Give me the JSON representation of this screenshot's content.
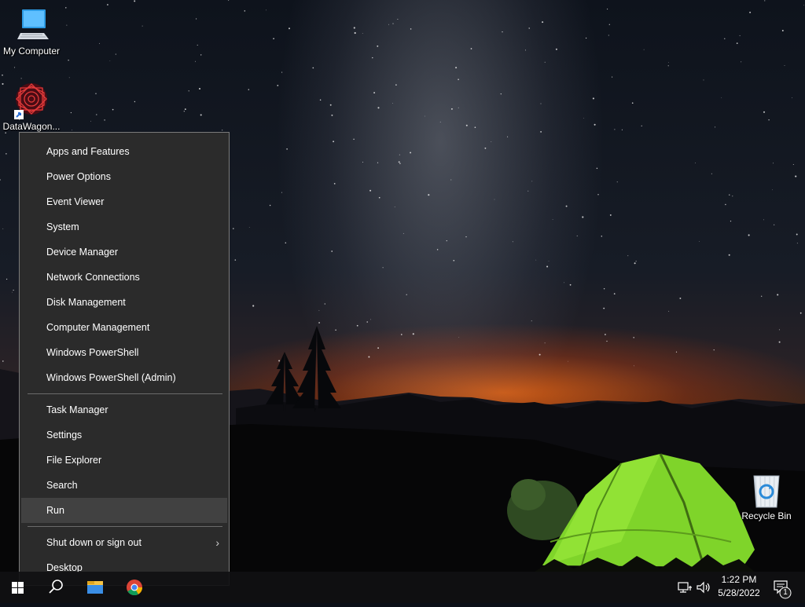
{
  "desktop": {
    "icons": [
      {
        "label": "My Computer",
        "icon": "computer-icon"
      },
      {
        "label": "DataWagon...",
        "icon": "datawagon-shortcut-icon"
      },
      {
        "label": "Recycle Bin",
        "icon": "recycle-bin-icon"
      }
    ]
  },
  "menu": {
    "group1": [
      "Apps and Features",
      "Power Options",
      "Event Viewer",
      "System",
      "Device Manager",
      "Network Connections",
      "Disk Management",
      "Computer Management",
      "Windows PowerShell",
      "Windows PowerShell (Admin)"
    ],
    "group2": [
      "Task Manager",
      "Settings",
      "File Explorer",
      "Search",
      "Run"
    ],
    "group3": [
      "Shut down or sign out",
      "Desktop"
    ],
    "highlighted": "Run",
    "submenu_glyph": "›"
  },
  "taskbar": {
    "items": [
      "start-icon",
      "search-icon",
      "file-explorer-icon",
      "chrome-icon"
    ],
    "tray": {
      "time": "1:22 PM",
      "date": "5/28/2022",
      "notification_count": "1"
    }
  },
  "colors": {
    "menu_bg": "#2b2b2b",
    "menu_hover": "#414141",
    "tent_green": "#7fd42a",
    "horizon_orange": "#ff6e14"
  }
}
